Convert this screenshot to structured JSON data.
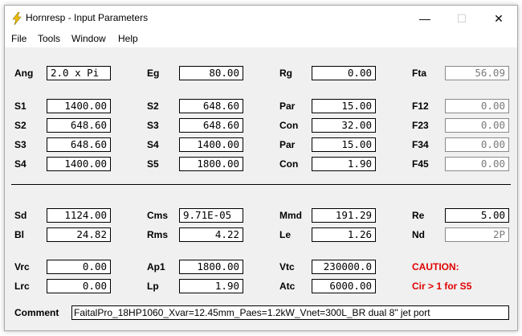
{
  "window": {
    "title": "Hornresp - Input Parameters",
    "minimize": "—",
    "maximize": "☐",
    "close": "✕",
    "icon": "lightning-icon",
    "accent": "#f0c000"
  },
  "menu": [
    "File",
    "Tools",
    "Window",
    "Help"
  ],
  "params": {
    "Ang": {
      "label": "Ang",
      "value": "2.0 x Pi"
    },
    "Eg": {
      "label": "Eg",
      "value": "80.00"
    },
    "Rg": {
      "label": "Rg",
      "value": "0.00"
    },
    "Fta": {
      "label": "Fta",
      "value": "56.09"
    },
    "S1": {
      "label": "S1",
      "value": "1400.00"
    },
    "S2": {
      "label": "S2",
      "value": "648.60"
    },
    "Par1": {
      "label": "Par",
      "value": "15.00"
    },
    "F12": {
      "label": "F12",
      "value": "0.00"
    },
    "S2b": {
      "label": "S2",
      "value": "648.60"
    },
    "S3": {
      "label": "S3",
      "value": "648.60"
    },
    "Con1": {
      "label": "Con",
      "value": "32.00"
    },
    "F23": {
      "label": "F23",
      "value": "0.00"
    },
    "S3b": {
      "label": "S3",
      "value": "648.60"
    },
    "S4": {
      "label": "S4",
      "value": "1400.00"
    },
    "Par2": {
      "label": "Par",
      "value": "15.00"
    },
    "F34": {
      "label": "F34",
      "value": "0.00"
    },
    "S4b": {
      "label": "S4",
      "value": "1400.00"
    },
    "S5": {
      "label": "S5",
      "value": "1800.00"
    },
    "Con2": {
      "label": "Con",
      "value": "1.90"
    },
    "F45": {
      "label": "F45",
      "value": "0.00"
    },
    "Sd": {
      "label": "Sd",
      "value": "1124.00"
    },
    "Cms": {
      "label": "Cms",
      "value": "9.71E-05"
    },
    "Mmd": {
      "label": "Mmd",
      "value": "191.29"
    },
    "Re": {
      "label": "Re",
      "value": "5.00"
    },
    "Bl": {
      "label": "Bl",
      "value": "24.82"
    },
    "Rms": {
      "label": "Rms",
      "value": "4.22"
    },
    "Le": {
      "label": "Le",
      "value": "1.26"
    },
    "Nd": {
      "label": "Nd",
      "value": "2P"
    },
    "Vrc": {
      "label": "Vrc",
      "value": "0.00"
    },
    "Ap1": {
      "label": "Ap1",
      "value": "1800.00"
    },
    "Vtc": {
      "label": "Vtc",
      "value": "230000.0"
    },
    "Lrc": {
      "label": "Lrc",
      "value": "0.00"
    },
    "Lp": {
      "label": "Lp",
      "value": "1.90"
    },
    "Atc": {
      "label": "Atc",
      "value": "6000.00"
    }
  },
  "caution": {
    "title": "CAUTION:",
    "message": "Cir > 1 for S5",
    "color": "#e00000"
  },
  "comment": {
    "label": "Comment",
    "value": "FaitalPro_18HP1060_Xvar=12.45mm_Paes=1.2kW_Vnet=300L_BR dual 8\" jet port"
  }
}
